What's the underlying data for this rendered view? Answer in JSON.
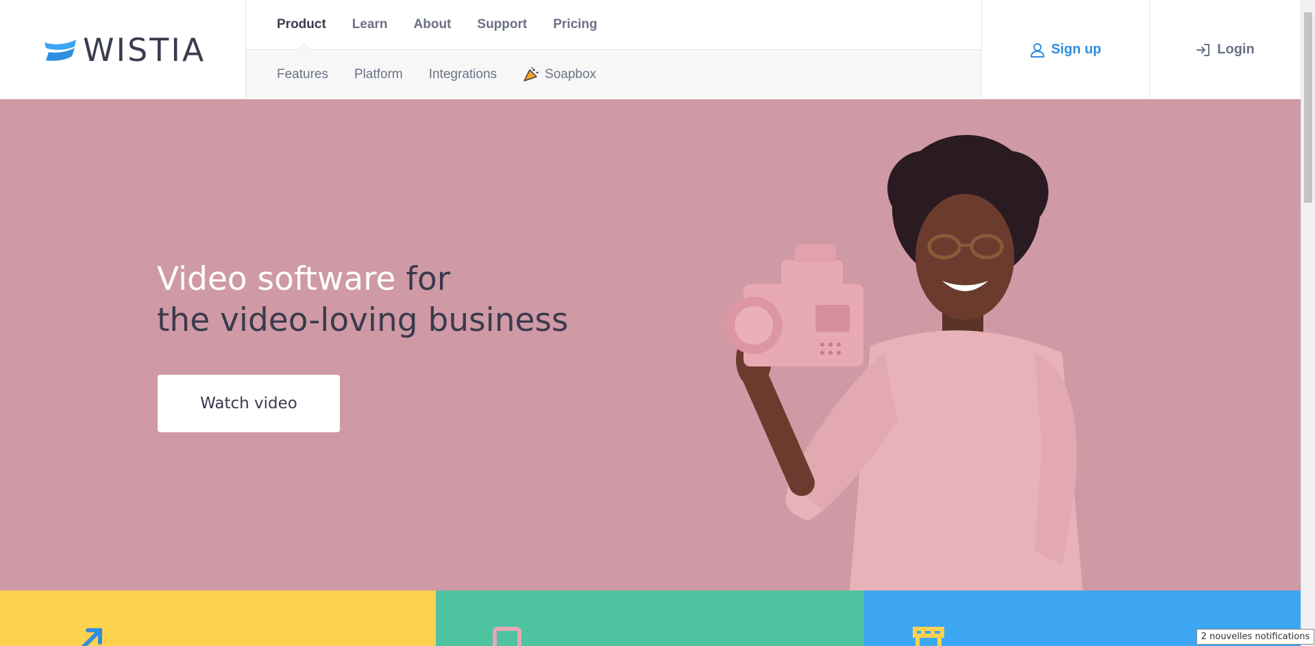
{
  "brand": {
    "name": "WISTIA",
    "accent": "#2f8ee0",
    "logo_icon": "wistia-wave-icon"
  },
  "nav": {
    "primary": [
      {
        "label": "Product",
        "active": true
      },
      {
        "label": "Learn",
        "active": false
      },
      {
        "label": "About",
        "active": false
      },
      {
        "label": "Support",
        "active": false
      },
      {
        "label": "Pricing",
        "active": false
      }
    ],
    "secondary": [
      {
        "label": "Features"
      },
      {
        "label": "Platform"
      },
      {
        "label": "Integrations"
      },
      {
        "label": "Soapbox",
        "icon": "party-horn-icon"
      }
    ]
  },
  "auth": {
    "signup": {
      "label": "Sign up",
      "icon": "user-icon"
    },
    "login": {
      "label": "Login",
      "icon": "login-arrow-icon"
    }
  },
  "hero": {
    "title_highlight": "Video software",
    "title_rest": " for",
    "title_line2": "the video-loving business",
    "cta": "Watch video",
    "background": "#cf9aa5"
  },
  "strip": {
    "tiles": [
      {
        "color": "#fdd24e",
        "icon": "arrow-up-right-icon"
      },
      {
        "color": "#4fc3a0",
        "icon": "tablet-icon"
      },
      {
        "color": "#3da6f2",
        "icon": "store-icon"
      }
    ]
  },
  "notification": {
    "text": "2 nouvelles notifications"
  }
}
